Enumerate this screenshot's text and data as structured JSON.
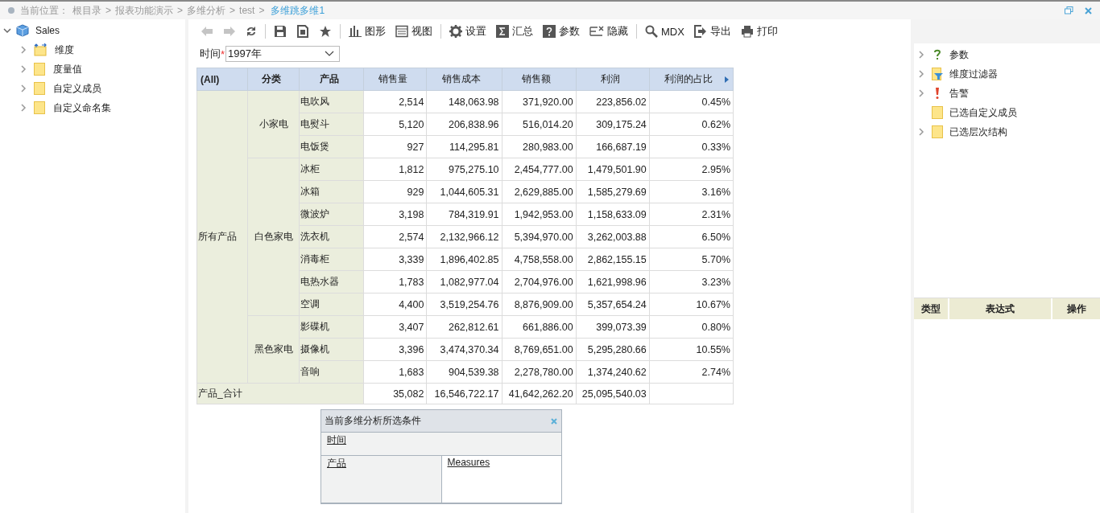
{
  "breadcrumb": {
    "label": "当前位置：",
    "path": [
      "根目录",
      "报表功能演示",
      "多维分析",
      "test"
    ],
    "separator": ">",
    "current": "多维跳多维1"
  },
  "left_tree": [
    {
      "label": "Sales",
      "kind": "cube",
      "expanded": true,
      "children": [
        {
          "label": "维度",
          "kind": "dimension",
          "expanded": false
        },
        {
          "label": "度量值",
          "kind": "folder",
          "expanded": false
        },
        {
          "label": "自定义成员",
          "kind": "folder",
          "expanded": false
        },
        {
          "label": "自定义命名集",
          "kind": "folder",
          "expanded": false
        }
      ]
    }
  ],
  "toolbar": [
    [
      {
        "kind": "back",
        "disabled": true
      },
      {
        "kind": "forward",
        "disabled": true
      },
      {
        "kind": "refresh",
        "disabled": false
      }
    ],
    [
      {
        "kind": "save",
        "disabled": false
      },
      {
        "kind": "save-as",
        "disabled": false
      },
      {
        "kind": "star",
        "disabled": false
      }
    ],
    [
      {
        "kind": "chart",
        "label": "图形",
        "disabled": false
      },
      {
        "kind": "view",
        "label": "视图",
        "disabled": false
      }
    ],
    [
      {
        "kind": "gear",
        "label": "设置",
        "disabled": false
      },
      {
        "kind": "sigma",
        "label": "汇总",
        "disabled": false
      },
      {
        "kind": "question",
        "label": "参数",
        "disabled": false
      },
      {
        "kind": "hide",
        "label": "隐藏",
        "disabled": false
      }
    ],
    [
      {
        "kind": "search",
        "label": "MDX",
        "disabled": false
      },
      {
        "kind": "export",
        "label": "导出",
        "disabled": false
      },
      {
        "kind": "print",
        "label": "打印",
        "disabled": false
      }
    ]
  ],
  "filter": {
    "label": "时间",
    "required_mark": "*",
    "value": "1997年"
  },
  "table": {
    "columns": [
      "(All)",
      "分类",
      "产品",
      "销售量",
      "销售成本",
      "销售额",
      "利润",
      "利润的占比"
    ],
    "all_label": "所有产品",
    "categories": [
      {
        "name": "小家电",
        "products": [
          {
            "name": "电吹风",
            "values": [
              "2,514",
              "148,063.98",
              "371,920.00",
              "223,856.02",
              "0.45%"
            ]
          },
          {
            "name": "电熨斗",
            "values": [
              "5,120",
              "206,838.96",
              "516,014.20",
              "309,175.24",
              "0.62%"
            ]
          },
          {
            "name": "电饭煲",
            "values": [
              "927",
              "114,295.81",
              "280,983.00",
              "166,687.19",
              "0.33%"
            ]
          }
        ]
      },
      {
        "name": "白色家电",
        "products": [
          {
            "name": "冰柜",
            "values": [
              "1,812",
              "975,275.10",
              "2,454,777.00",
              "1,479,501.90",
              "2.95%"
            ]
          },
          {
            "name": "冰箱",
            "values": [
              "929",
              "1,044,605.31",
              "2,629,885.00",
              "1,585,279.69",
              "3.16%"
            ]
          },
          {
            "name": "微波炉",
            "values": [
              "3,198",
              "784,319.91",
              "1,942,953.00",
              "1,158,633.09",
              "2.31%"
            ]
          },
          {
            "name": "洗衣机",
            "values": [
              "2,574",
              "2,132,966.12",
              "5,394,970.00",
              "3,262,003.88",
              "6.50%"
            ]
          },
          {
            "name": "消毒柜",
            "values": [
              "3,339",
              "1,896,402.85",
              "4,758,558.00",
              "2,862,155.15",
              "5.70%"
            ]
          },
          {
            "name": "电热水器",
            "values": [
              "1,783",
              "1,082,977.04",
              "2,704,976.00",
              "1,621,998.96",
              "3.23%"
            ]
          },
          {
            "name": "空调",
            "values": [
              "4,400",
              "3,519,254.76",
              "8,876,909.00",
              "5,357,654.24",
              "10.67%"
            ]
          }
        ]
      },
      {
        "name": "黑色家电",
        "products": [
          {
            "name": "影碟机",
            "values": [
              "3,407",
              "262,812.61",
              "661,886.00",
              "399,073.39",
              "0.80%"
            ]
          },
          {
            "name": "摄像机",
            "values": [
              "3,396",
              "3,474,370.34",
              "8,769,651.00",
              "5,295,280.66",
              "10.55%"
            ]
          },
          {
            "name": "音响",
            "values": [
              "1,683",
              "904,539.38",
              "2,278,780.00",
              "1,374,240.62",
              "2.74%"
            ]
          }
        ]
      }
    ],
    "total": {
      "label": "产品_合计",
      "values": [
        "35,082",
        "16,546,722.17",
        "41,642,262.20",
        "25,095,540.03"
      ]
    }
  },
  "conditions": {
    "title": "当前多维分析所选条件",
    "rows": [
      [
        "时间"
      ],
      [
        "产品",
        "Measures"
      ]
    ]
  },
  "right_tree": [
    {
      "label": "参数",
      "kind": "question",
      "expandable": true
    },
    {
      "label": "维度过滤器",
      "kind": "filter",
      "expandable": true
    },
    {
      "label": "告警",
      "kind": "alert",
      "expandable": true
    },
    {
      "label": "已选自定义成员",
      "kind": "folder",
      "expandable": false
    },
    {
      "label": "已选层次结构",
      "kind": "folder",
      "expandable": true
    }
  ],
  "expression_table": {
    "columns": [
      "类型",
      "表达式",
      "操作"
    ]
  }
}
